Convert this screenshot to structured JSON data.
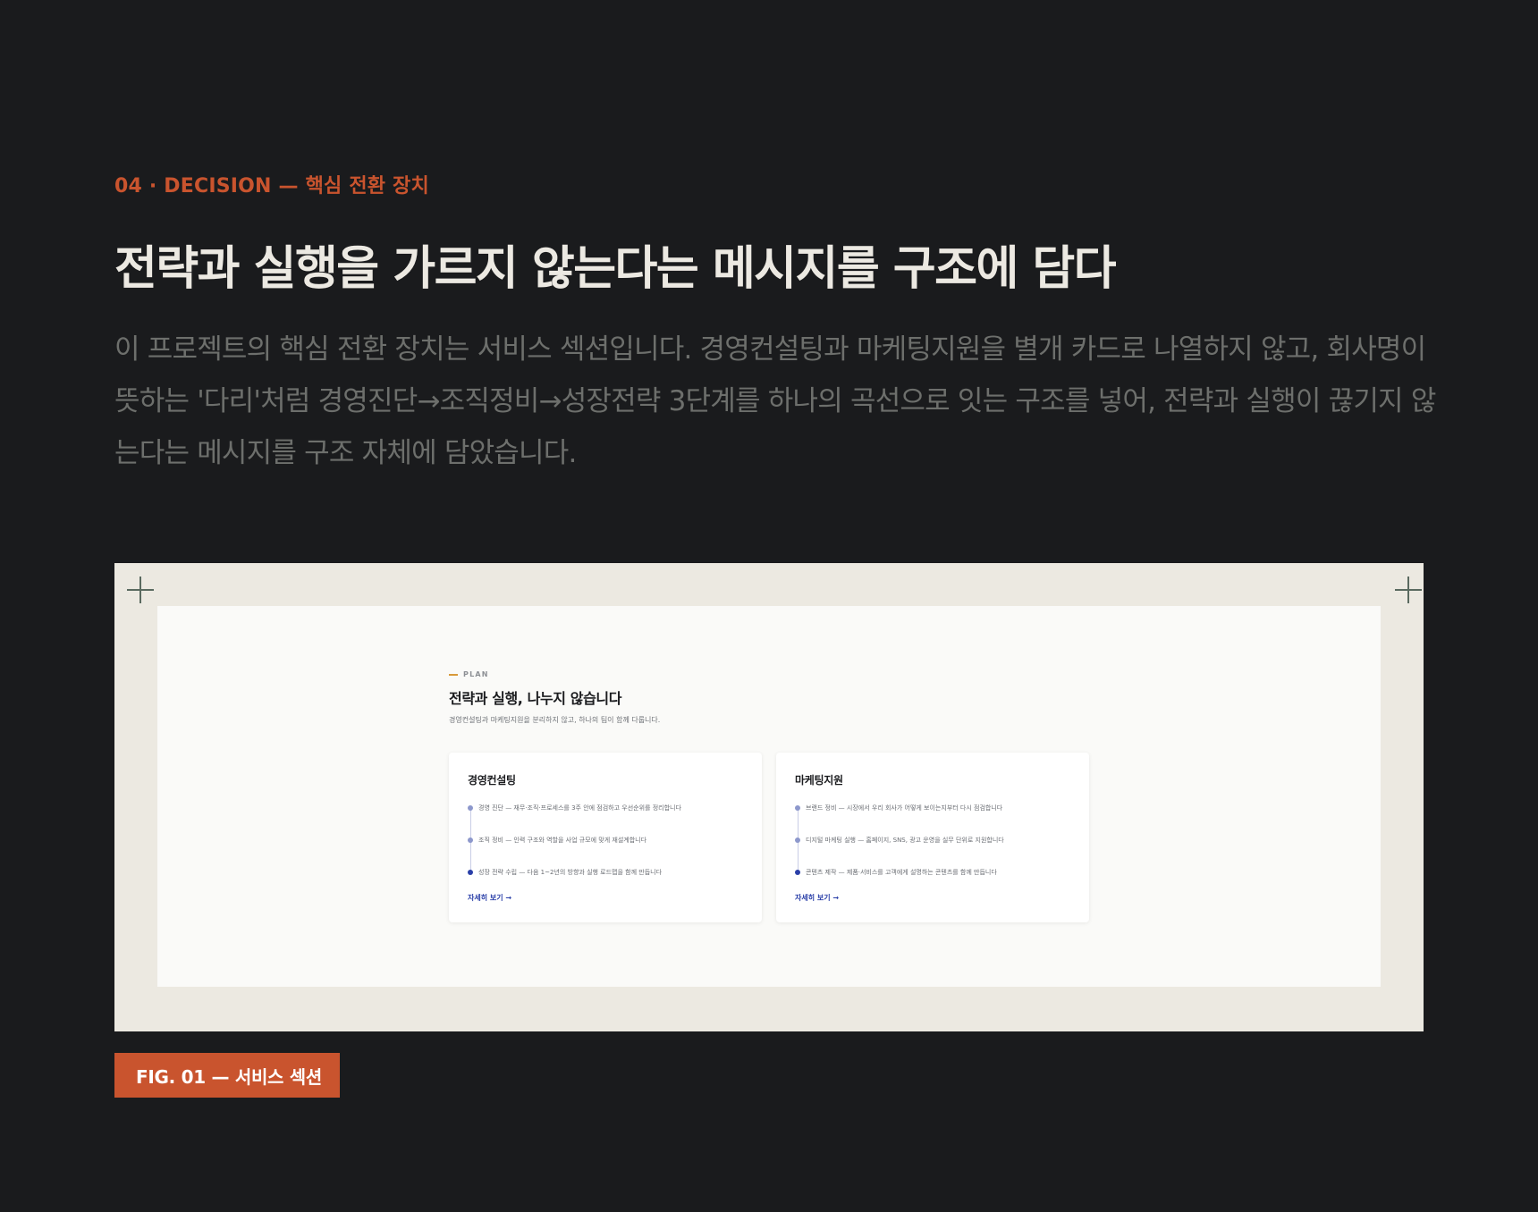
{
  "section": {
    "eyebrow": "04 · DECISION — 핵심 전환 장치",
    "headline": "전략과 실행을 가르지 않는다는 메시지를 구조에 담다",
    "lead": "이 프로젝트의 핵심 전환 장치는 서비스 섹션입니다. 경영컨설팅과 마케팅지원을 별개 카드로 나열하지 않고, 회사명이 뜻하는 '다리'처럼 경영진단→조직정비→성장전략 3단계를 하나의 곡선으로 잇는 구조를 넣어, 전략과 실행이 끊기지 않는다는 메시지를 구조 자체에 담았습니다."
  },
  "figure": {
    "caption": "FIG. 01 — 서비스 섹션",
    "frame_color": "#ece9e1",
    "screen": {
      "tag": "PLAN",
      "title": "전략과 실행, 나누지 않습니다",
      "subtitle": "경영컨설팅과 마케팅지원을 분리하지 않고, 하나의 팀이 함께 다룹니다.",
      "cards": [
        {
          "title": "경영컨설팅",
          "steps": [
            "경영 진단 — 재무·조직·프로세스를 3주 안에 점검하고 우선순위를 정리합니다",
            "조직 정비 — 인력 구조와 역할을 사업 규모에 맞게 재설계합니다",
            "성장 전략 수립 — 다음 1~2년의 방향과 실행 로드맵을 함께 만듭니다"
          ],
          "link": "자세히 보기 →"
        },
        {
          "title": "마케팅지원",
          "steps": [
            "브랜드 정비 — 시장에서 우리 회사가 어떻게 보이는지부터 다시 점검합니다",
            "디지털 마케팅 실행 — 홈페이지, SNS, 광고 운영을 실무 단위로 지원합니다",
            "콘텐츠 제작 — 제품·서비스를 고객에게 설명하는 콘텐츠를 함께 만듭니다"
          ],
          "link": "자세히 보기 →"
        }
      ]
    }
  },
  "colors": {
    "background": "#1a1b1d",
    "accent": "#c9542e",
    "link_blue": "#2a3fa8"
  },
  "icons": [
    "crosshair-icon",
    "arrow-right-icon"
  ]
}
